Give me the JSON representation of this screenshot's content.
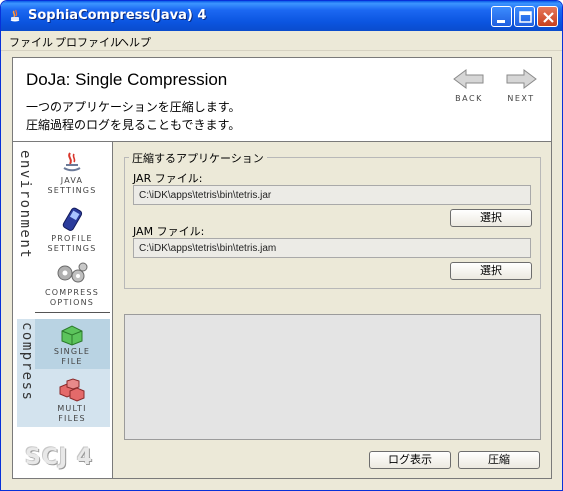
{
  "window": {
    "title": "SophiaCompress(Java) 4",
    "controls": [
      "minimize-icon",
      "maximize-icon",
      "close-icon"
    ]
  },
  "menu": {
    "items": [
      "ファイル",
      "プロファイル",
      "ヘルプ"
    ]
  },
  "header": {
    "title": "DoJa: Single Compression",
    "desc_line1": "一つのアプリケーションを圧縮します。",
    "desc_line2": "圧縮過程のログを見ることもできます。",
    "back_label": "BACK",
    "next_label": "NEXT"
  },
  "sidebar": {
    "environment_label": "environment",
    "compress_label": "compress",
    "java_settings": [
      "JAVA",
      "SETTINGS"
    ],
    "profile_settings": [
      "PROFILE",
      "SETTINGS"
    ],
    "compress_options": [
      "COMPRESS",
      "OPTIONS"
    ],
    "single_file": [
      "SINGLE",
      "FILE"
    ],
    "multi_files": [
      "MULTI",
      "FILES"
    ],
    "logo": "SCJ 4"
  },
  "content": {
    "group_title": "圧縮するアプリケーション",
    "jar_label": "JAR ファイル:",
    "jar_value": "C:\\iDK\\apps\\tetris\\bin\\tetris.jar",
    "jar_select_label": "選択",
    "jam_label": "JAM ファイル:",
    "jam_value": "C:\\iDK\\apps\\tetris\\bin\\tetris.jam",
    "jam_select_label": "選択",
    "log_button_label": "ログ表示",
    "compress_button_label": "圧縮"
  },
  "colors": {
    "titlebar": "#0a5de8",
    "window_bg": "#ece9d8",
    "selected_nav": "#b9d3e3",
    "compress_band": "#d3e3ee"
  }
}
